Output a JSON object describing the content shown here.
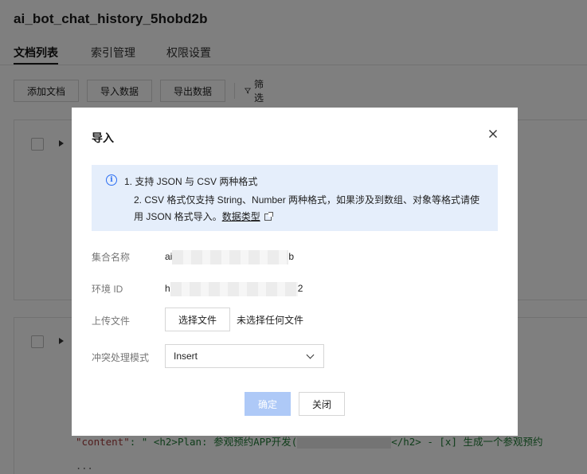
{
  "page": {
    "title": "ai_bot_chat_history_5hobd2b",
    "tabs": [
      {
        "label": "文档列表",
        "active": true
      },
      {
        "label": "索引管理",
        "active": false
      },
      {
        "label": "权限设置",
        "active": false
      }
    ],
    "toolbar": {
      "add_doc": "添加文档",
      "import_data": "导入数据",
      "export_data": "导出数据",
      "filter": "筛选"
    },
    "code_preview": {
      "key": "\"content\"",
      "sep": ": \" ",
      "text_before": "<h2>Plan: 参观预约APP开发(",
      "text_after": "</h2> - [x] 生成一个参观预约",
      "ellipsis": "..."
    }
  },
  "modal": {
    "title": "导入",
    "notice": {
      "line1": "1. 支持 JSON 与 CSV 两种格式",
      "line2": "2. CSV 格式仅支持 String、Number 两种格式，如果涉及到数组、对象等格式请使",
      "line3_prefix": "用 JSON 格式导入。",
      "link": "数据类型"
    },
    "fields": {
      "collection_label": "集合名称",
      "collection_prefix": "ai",
      "collection_suffix": "b",
      "env_label": "环境 ID",
      "env_prefix": "h",
      "env_suffix": "2",
      "upload_label": "上传文件",
      "choose_file": "选择文件",
      "no_file": "未选择任何文件",
      "conflict_label": "冲突处理模式",
      "conflict_value": "Insert"
    },
    "buttons": {
      "confirm": "确定",
      "close": "关闭"
    }
  },
  "colors": {
    "accent": "#2b6ef2",
    "notice_bg": "#e5eefb",
    "confirm_disabled": "#aec9f7",
    "code_string": "#1f7a34",
    "code_key": "#a33b3b"
  }
}
